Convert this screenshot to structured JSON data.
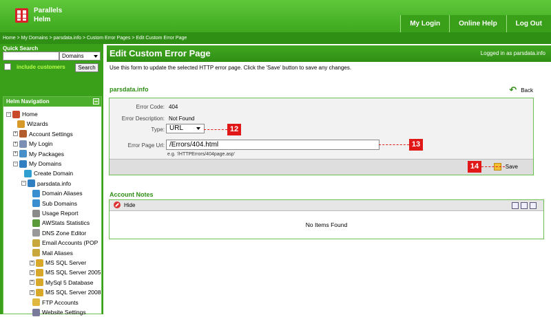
{
  "header": {
    "brand_line1": "Parallels",
    "brand_line2": "Helm",
    "nav": [
      "My Login",
      "Online Help",
      "Log Out"
    ]
  },
  "breadcrumb": "Home > My Domains > parsdata.info > Custom Error Pages > Edit Custom Error Page",
  "quick_search": {
    "title": "Quick Search",
    "input_value": "",
    "select_value": "Domains",
    "include_label": "include customers",
    "search_label": "Search"
  },
  "navigation": {
    "title": "Helm Navigation",
    "items": [
      {
        "label": "Home",
        "icon": "home-icon",
        "color": "#c84a2a"
      },
      {
        "label": "Wizards",
        "icon": "wizard-icon",
        "color": "#d79a2a"
      },
      {
        "label": "Account Settings",
        "icon": "users-icon",
        "color": "#b35c2c"
      },
      {
        "label": "My Login",
        "icon": "login-icon",
        "color": "#7a8fb3"
      },
      {
        "label": "My Packages",
        "icon": "package-icon",
        "color": "#4a90c8"
      },
      {
        "label": "My Domains",
        "icon": "globe-icon",
        "color": "#2f7fc2"
      },
      {
        "label": "Create Domain",
        "icon": "globe-add-icon",
        "color": "#2f9fd2"
      },
      {
        "label": "parsdata.info",
        "icon": "globe-icon",
        "color": "#2f7fc2"
      },
      {
        "label": "Domain Aliases",
        "icon": "alias-icon",
        "color": "#3a8fd0"
      },
      {
        "label": "Sub Domains",
        "icon": "subdomain-icon",
        "color": "#3a8fd0"
      },
      {
        "label": "Usage Report",
        "icon": "report-icon",
        "color": "#8a8a8a"
      },
      {
        "label": "AWStats Statistics",
        "icon": "stats-icon",
        "color": "#5a9a3a"
      },
      {
        "label": "DNS Zone Editor",
        "icon": "dns-icon",
        "color": "#999999"
      },
      {
        "label": "Email Accounts (POP",
        "icon": "email-icon",
        "color": "#c8a83a"
      },
      {
        "label": "Mail Aliases",
        "icon": "mail-alias-icon",
        "color": "#c8a83a"
      },
      {
        "label": "MS SQL Server",
        "icon": "database-icon",
        "color": "#d8a82a"
      },
      {
        "label": "MS SQL Server 2005",
        "icon": "database-icon",
        "color": "#d8a82a"
      },
      {
        "label": "MySql 5 Database",
        "icon": "database-icon",
        "color": "#d8a82a"
      },
      {
        "label": "MS SQL Server 2008",
        "icon": "database-icon",
        "color": "#d8a82a"
      },
      {
        "label": "FTP Accounts",
        "icon": "folder-icon",
        "color": "#e0b840"
      },
      {
        "label": "Website Settings",
        "icon": "settings-icon",
        "color": "#7a7a9a"
      }
    ]
  },
  "main": {
    "title": "Edit Custom Error Page",
    "logged_in": "Logged in as parsdata.info",
    "intro": "Use this form to update the selected HTTP error page. Click the 'Save' button to save any changes.",
    "section_title": "parsdata.info",
    "back_label": "Back",
    "form": {
      "error_code_label": "Error Code:",
      "error_code_value": "404",
      "error_desc_label": "Error Description:",
      "error_desc_value": "Not Found",
      "type_label": "Type:",
      "type_value": "URL",
      "url_label": "Error Page Url:",
      "url_value": "/Errors/404.html",
      "url_hint": "e.g. '/HTTPErrors/404page.asp'",
      "save_label": "Save"
    },
    "callouts": [
      "12",
      "13",
      "14"
    ],
    "notes": {
      "title": "Account Notes",
      "hide_label": "Hide",
      "empty_text": "No Items Found"
    }
  }
}
